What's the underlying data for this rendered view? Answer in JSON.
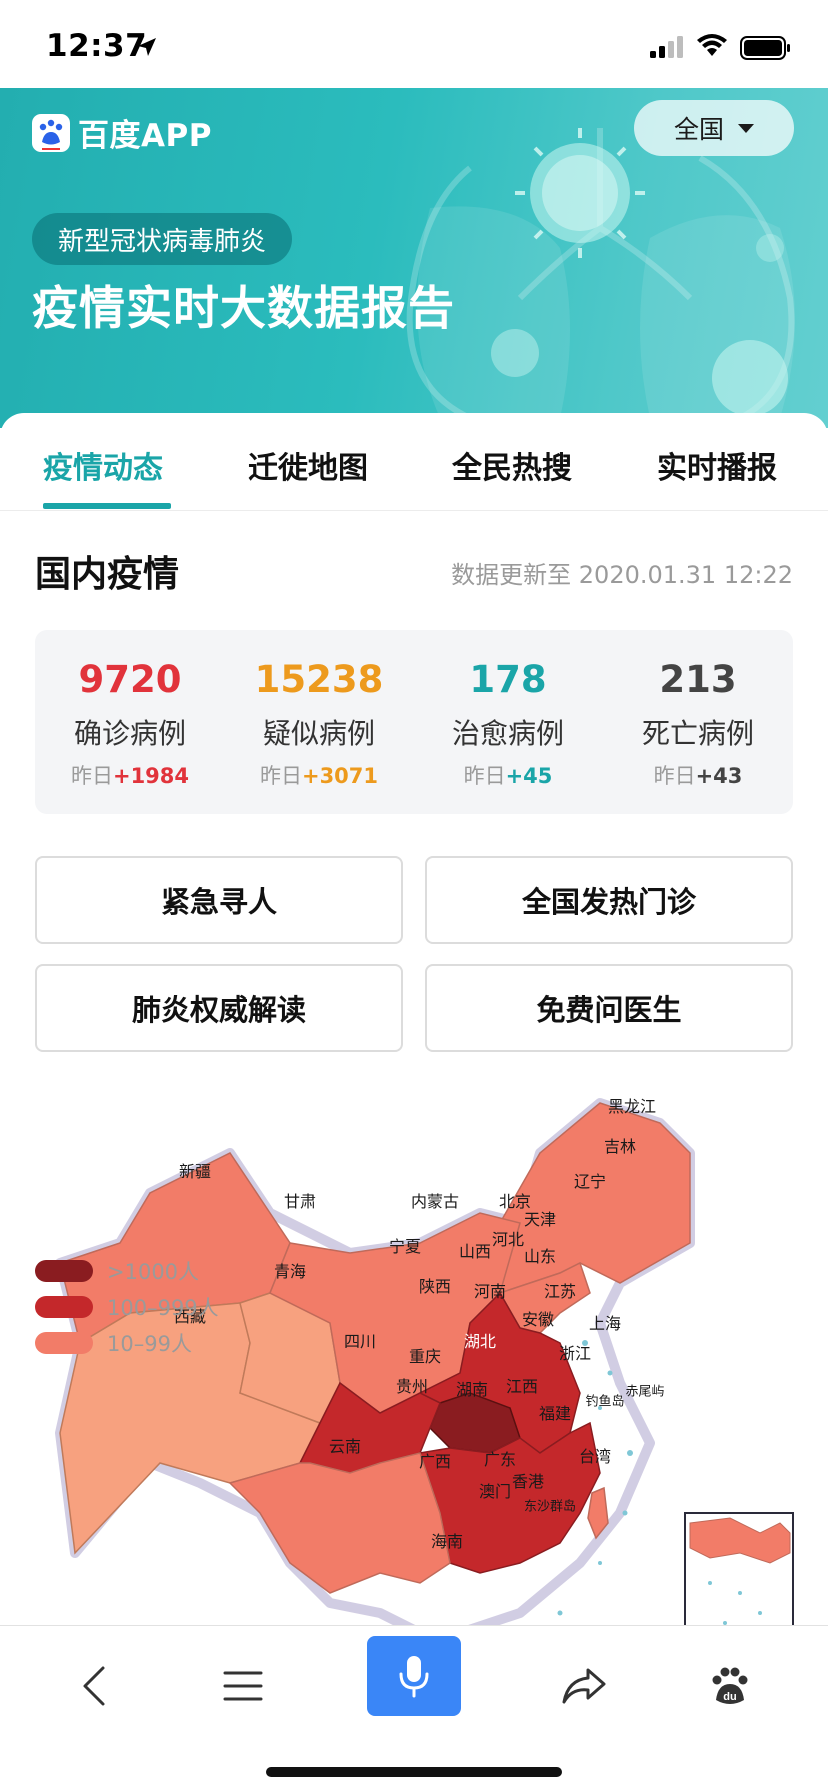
{
  "status_bar": {
    "time": "12:37"
  },
  "header": {
    "app_name": "百度APP",
    "region_selector": "全国",
    "topic": "新型冠状病毒肺炎",
    "title": "疫情实时大数据报告"
  },
  "tabs": [
    {
      "label": "疫情动态",
      "active": true
    },
    {
      "label": "迁徙地图",
      "active": false
    },
    {
      "label": "全民热搜",
      "active": false
    },
    {
      "label": "实时播报",
      "active": false
    }
  ],
  "domestic": {
    "title": "国内疫情",
    "updated": "数据更新至 2020.01.31 12:22",
    "stats": [
      {
        "value": "9720",
        "label": "确诊病例",
        "delta_prefix": "昨日",
        "delta": "+1984",
        "color": "#e1333b"
      },
      {
        "value": "15238",
        "label": "疑似病例",
        "delta_prefix": "昨日",
        "delta": "+3071",
        "color": "#ed9a1d"
      },
      {
        "value": "178",
        "label": "治愈病例",
        "delta_prefix": "昨日",
        "delta": "+45",
        "color": "#1aa5a8"
      },
      {
        "value": "213",
        "label": "死亡病例",
        "delta_prefix": "昨日",
        "delta": "+43",
        "color": "#444444"
      }
    ]
  },
  "actions": [
    "紧急寻人",
    "全国发热门诊",
    "肺炎权威解读",
    "免费问医生"
  ],
  "map": {
    "provinces": [
      "黑龙江",
      "吉林",
      "辽宁",
      "新疆",
      "甘肃",
      "内蒙古",
      "北京",
      "天津",
      "河北",
      "宁夏",
      "山西",
      "山东",
      "青海",
      "西藏",
      "陕西",
      "河南",
      "江苏",
      "安徽",
      "四川",
      "湖北",
      "上海",
      "重庆",
      "浙江",
      "贵州",
      "湖南",
      "江西",
      "福建",
      "钓鱼岛",
      "赤尾屿",
      "云南",
      "广西",
      "广东",
      "台湾",
      "香港",
      "澳门",
      "东沙群岛",
      "海南"
    ],
    "legend": [
      {
        "label": ">1000人",
        "color": "#8a1c20"
      },
      {
        "label": "100–999人",
        "color": "#c4282b"
      },
      {
        "label": "10–99人",
        "color": "#f27c68"
      }
    ]
  },
  "colors": {
    "accent": "#1aa5a8",
    "banner": "#2bbcbd",
    "mic": "#3a86f7"
  },
  "bottom_nav": [
    "back-icon",
    "menu-icon",
    "mic-icon",
    "share-icon",
    "baidu-paw-icon"
  ]
}
